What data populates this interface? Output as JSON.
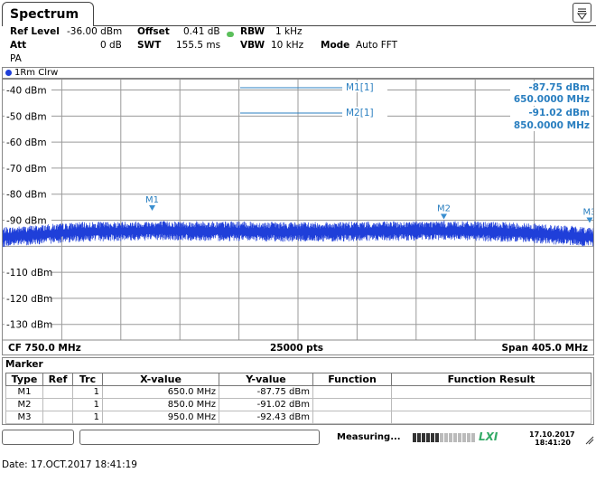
{
  "tab": {
    "title": "Spectrum"
  },
  "settings": {
    "ref_level_label": "Ref Level",
    "ref_level_value": "-36.00 dBm",
    "offset_label": "Offset",
    "offset_value": "0.41 dB",
    "rbw_label": "RBW",
    "rbw_value": "1 kHz",
    "att_label": "Att",
    "att_value": "0 dB",
    "swt_label": "SWT",
    "swt_value": "155.5 ms",
    "vbw_label": "VBW",
    "vbw_value": "10 kHz",
    "mode_label": "Mode",
    "mode_value": "Auto FFT",
    "pa_label": "PA"
  },
  "trace": {
    "label": "1Rm Clrw",
    "color": "#1f3fd9"
  },
  "plot": {
    "cf_label": "CF 750.0 MHz",
    "pts_label": "25000 pts",
    "span_label": "Span 405.0 MHz",
    "readout": [
      {
        "name": "M1[1]",
        "level": "-87.75 dBm",
        "freq": "650.0000 MHz"
      },
      {
        "name": "M2[1]",
        "level": "-91.02 dBm",
        "freq": "850.0000 MHz"
      }
    ],
    "marker_flags": [
      "M1",
      "M2",
      "M3"
    ]
  },
  "chart_data": {
    "type": "line",
    "x_range": [
      547.5,
      952.5
    ],
    "ylim": [
      -136,
      -36
    ],
    "ytick_labels": [
      "-40 dBm",
      "-50 dBm",
      "-60 dBm",
      "-70 dBm",
      "-80 dBm",
      "-90 dBm",
      "-110 dBm",
      "-120 dBm",
      "-130 dBm"
    ],
    "ytick_values": [
      -40,
      -50,
      -60,
      -70,
      -80,
      -90,
      -110,
      -120,
      -130
    ],
    "grid": true,
    "series": [
      {
        "x": [
          547.5,
          600,
          650,
          700,
          750,
          800,
          850,
          900,
          952.5
        ],
        "y": [
          -96.5,
          -94.5,
          -94.0,
          -94.2,
          -94.5,
          -94.3,
          -94.0,
          -94.6,
          -96.5
        ]
      }
    ],
    "markers": [
      {
        "label": "M1",
        "x": 650.0,
        "y": -87.75
      },
      {
        "label": "M2",
        "x": 850.0,
        "y": -91.02
      },
      {
        "label": "M3",
        "x": 950.0,
        "y": -92.43
      }
    ]
  },
  "marker_table": {
    "title": "Marker",
    "headers": [
      "Type",
      "Ref",
      "Trc",
      "X-value",
      "Y-value",
      "Function",
      "Function Result"
    ],
    "rows": [
      [
        "M1",
        "",
        "1",
        "650.0 MHz",
        "-87.75 dBm",
        "",
        ""
      ],
      [
        "M2",
        "",
        "1",
        "850.0 MHz",
        "-91.02 dBm",
        "",
        ""
      ],
      [
        "M3",
        "",
        "1",
        "950.0 MHz",
        "-92.43 dBm",
        "",
        ""
      ]
    ]
  },
  "status": {
    "measuring": "Measuring...",
    "progress": 0.4,
    "logo": "LXI",
    "date": "17.10.2017",
    "time": "18:41:20"
  },
  "footer": {
    "date_text": "Date: 17.OCT.2017  18:41:19"
  }
}
